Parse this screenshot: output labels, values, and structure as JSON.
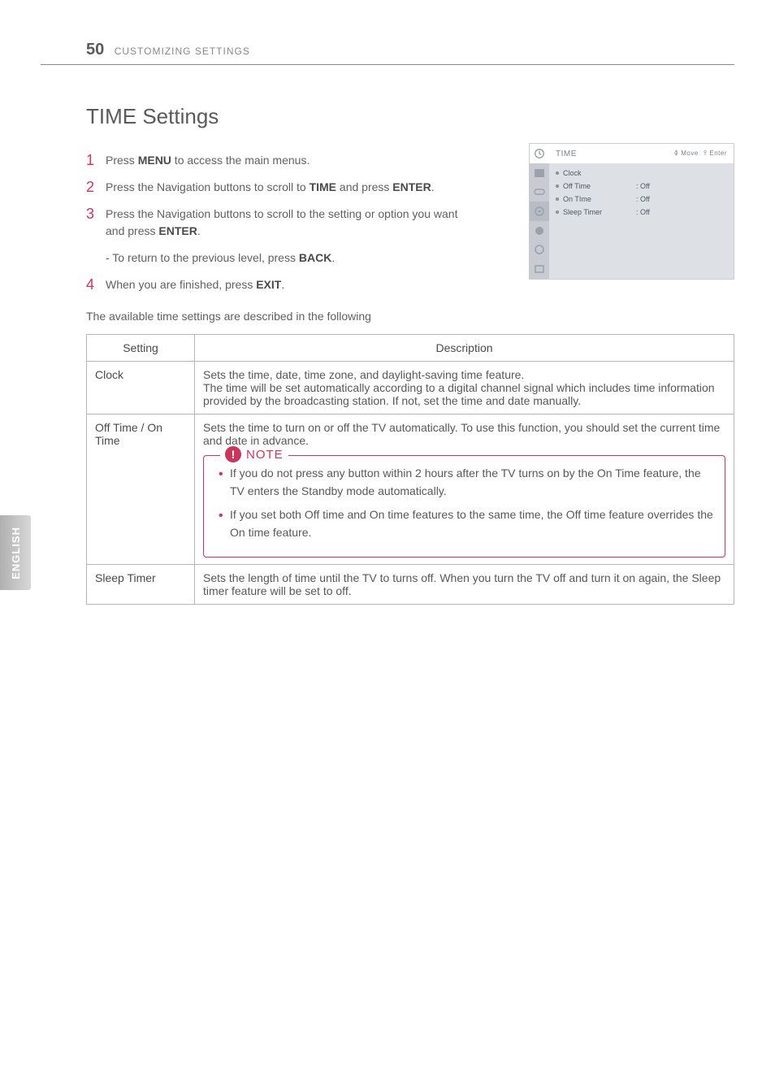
{
  "header": {
    "page_number": "50",
    "section": "CUSTOMIZING SETTINGS"
  },
  "title": "TIME Settings",
  "steps": [
    {
      "num": "1",
      "pre": "Press ",
      "b1": "MENU",
      "post": " to access the main menus."
    },
    {
      "num": "2",
      "pre": "Press the Navigation buttons to scroll to ",
      "b1": "TIME",
      "mid": " and press ",
      "b2": "ENTER",
      "post": "."
    },
    {
      "num": "3",
      "pre": "Press the Navigation buttons to scroll to the setting or option you want and press ",
      "b1": "ENTER",
      "post": ".",
      "sub_pre": "- To return to the previous level, press ",
      "sub_b": "BACK",
      "sub_post": "."
    },
    {
      "num": "4",
      "pre": "When you are finished, press ",
      "b1": "EXIT",
      "post": "."
    }
  ],
  "intro": "The available time settings are described in the following",
  "osd": {
    "title": "TIME",
    "hint_move": "Move",
    "hint_enter": "Enter",
    "items": [
      {
        "label": "Clock",
        "value": ""
      },
      {
        "label": "Off Time",
        "value": ": Off"
      },
      {
        "label": "On TIme",
        "value": ": Off"
      },
      {
        "label": "Sleep Timer",
        "value": ": Off"
      }
    ]
  },
  "table": {
    "head_setting": "Setting",
    "head_desc": "Description",
    "rows": {
      "clock": {
        "name": "Clock",
        "desc": "Sets the time, date, time zone, and daylight-saving time feature.\nThe time will be set automatically according to a digital channel signal which includes time information provided by the broadcasting station. If not, set the time and date manually."
      },
      "offon": {
        "name": "Off Time / On Time",
        "desc": "Sets the time to turn on or off the TV automatically. To use this function, you should set the current time and date in advance.",
        "note_label": "NOTE",
        "note1": "If you do not press any button within 2 hours after the TV turns on by the On Time feature, the TV enters the Standby mode automatically.",
        "note2": "If you set both Off time and On time features to the same time, the Off time feature overrides the On time feature."
      },
      "sleep": {
        "name": "Sleep Timer",
        "desc": "Sets the length of time until the TV to turns off. When you turn the TV off and turn it on again, the Sleep timer feature will be set to off."
      }
    }
  },
  "lang_tab": "ENGLISH"
}
